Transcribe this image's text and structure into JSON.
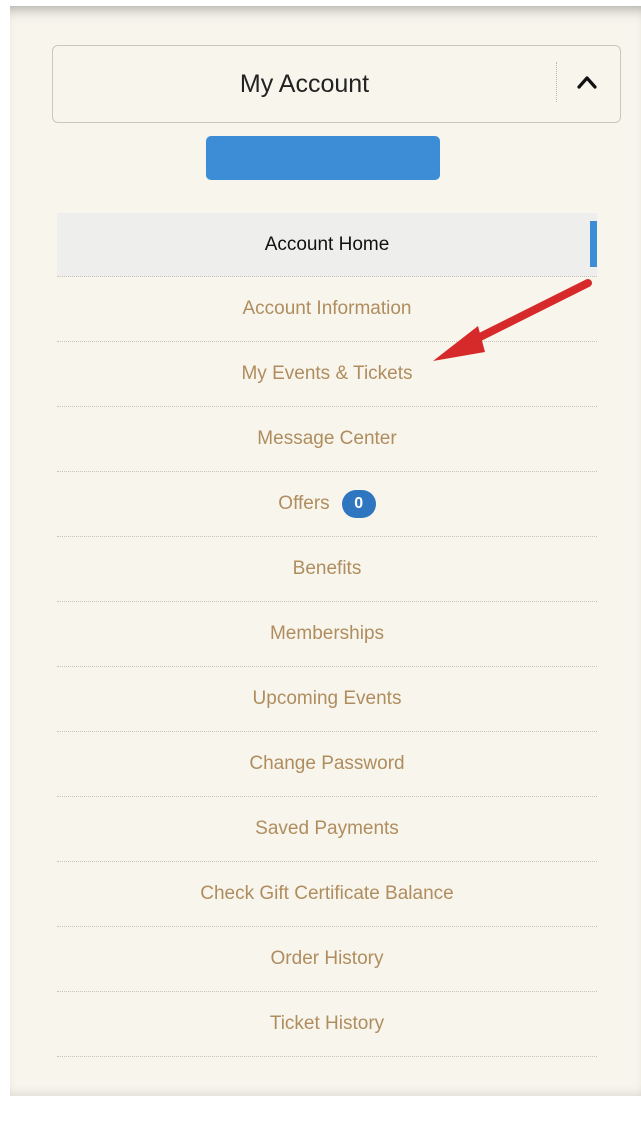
{
  "account": {
    "title": "My Account",
    "toggle_icon": "chevron-up-icon"
  },
  "button": {
    "label": "",
    "color": "#3c8dd6"
  },
  "menu": {
    "items": [
      {
        "label": "Account Home",
        "active": true
      },
      {
        "label": "Account Information"
      },
      {
        "label": "My Events & Tickets"
      },
      {
        "label": "Message Center"
      },
      {
        "label": "Offers",
        "badge": "0"
      },
      {
        "label": "Benefits"
      },
      {
        "label": "Memberships"
      },
      {
        "label": "Upcoming Events"
      },
      {
        "label": "Change Password"
      },
      {
        "label": "Saved Payments"
      },
      {
        "label": "Check Gift Certificate Balance"
      },
      {
        "label": "Order History"
      },
      {
        "label": "Ticket History"
      }
    ]
  },
  "annotation": {
    "type": "red-arrow",
    "target": "My Events & Tickets",
    "color": "#d62a2a"
  },
  "colors": {
    "accent": "#3c8dd6",
    "link": "#b08d5f",
    "background": "#f7f5ec"
  }
}
